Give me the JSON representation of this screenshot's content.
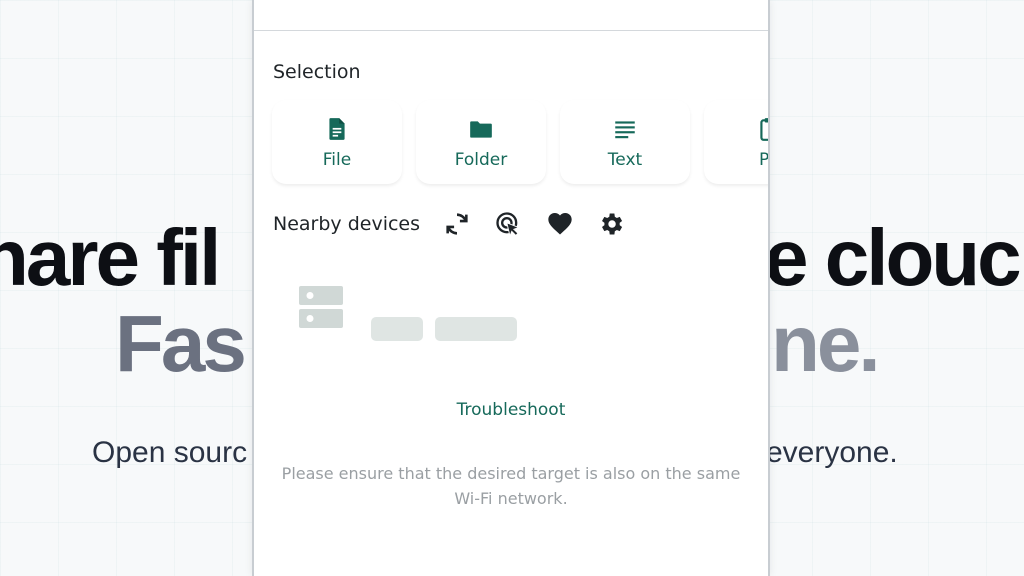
{
  "background": {
    "line1_left": "hare fil",
    "line1_right": "e clouc",
    "line2_left": "Fas",
    "line2_right": "ne.",
    "line3_left": "Open sourc",
    "line3_right": "everyone."
  },
  "selection": {
    "title": "Selection",
    "items": [
      {
        "label": "File",
        "icon": "file-icon"
      },
      {
        "label": "Folder",
        "icon": "folder-icon"
      },
      {
        "label": "Text",
        "icon": "text-icon"
      },
      {
        "label": "Pa",
        "icon": "paste-icon"
      }
    ]
  },
  "nearby": {
    "title": "Nearby devices",
    "tools": [
      "refresh-icon",
      "target-cursor-icon",
      "heart-icon",
      "gear-icon"
    ]
  },
  "troubleshoot_label": "Troubleshoot",
  "hint_text": "Please ensure that the desired target is also on the same Wi-Fi network.",
  "colors": {
    "accent": "#16695a",
    "skeleton": "#dfe5e3"
  }
}
